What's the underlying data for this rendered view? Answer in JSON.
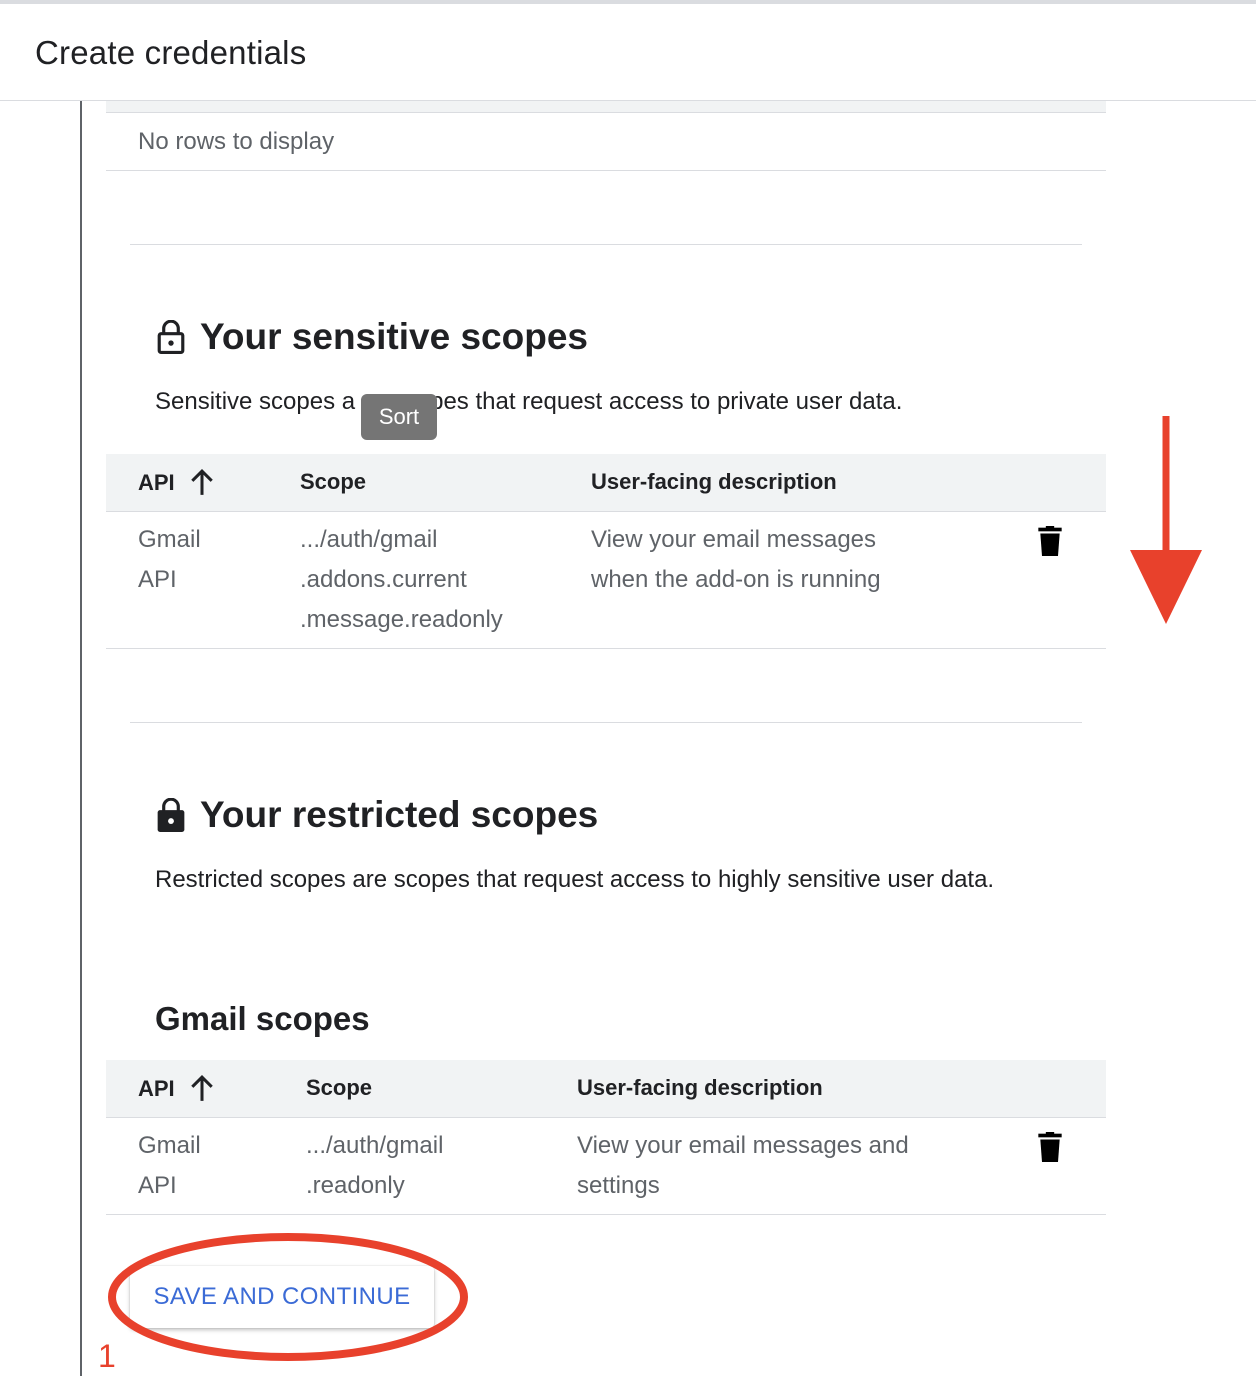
{
  "header": {
    "title": "Create credentials"
  },
  "top_table": {
    "empty_text": "No rows to display"
  },
  "sensitive": {
    "title": "Your sensitive scopes",
    "description": "Sensitive scopes a",
    "description_rest": "pes that request access to private user data.",
    "tooltip": "Sort",
    "columns": {
      "api": "API",
      "scope": "Scope",
      "description": "User-facing description"
    },
    "rows": [
      {
        "api": "Gmail\nAPI",
        "scope": ".../auth/gmail\n.addons.current\n.message.readonly",
        "description": "View your email messages\nwhen the add-on is running"
      }
    ]
  },
  "restricted": {
    "title": "Your restricted scopes",
    "description": "Restricted scopes are scopes that request access to highly sensitive user data.",
    "gmail_heading": "Gmail scopes",
    "columns": {
      "api": "API",
      "scope": "Scope",
      "description": "User-facing description"
    },
    "rows": [
      {
        "api": "Gmail\nAPI",
        "scope": ".../auth/gmail\n.readonly",
        "description": "View your email messages and\nsettings"
      }
    ]
  },
  "actions": {
    "save_label": "SAVE AND CONTINUE"
  },
  "annotation": {
    "step_number": "1",
    "color": "#e8412c"
  },
  "colors": {
    "link_blue": "#3b6bd6",
    "header_grey": "#f1f3f4",
    "border": "#dadce0"
  }
}
